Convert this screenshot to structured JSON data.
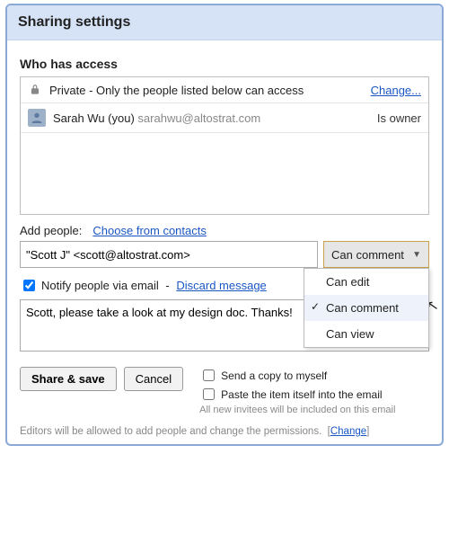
{
  "dialog": {
    "title": "Sharing settings"
  },
  "access": {
    "heading": "Who has access",
    "privacy_text": "Private - Only the people listed below can access",
    "change_link": "Change...",
    "owner": {
      "name": "Sarah Wu (you)",
      "email": "sarahwu@altostrat.com",
      "role": "Is owner"
    }
  },
  "add": {
    "label": "Add people:",
    "contacts_link": "Choose from contacts",
    "people_value": "\"Scott J\" <scott@altostrat.com>",
    "perm_selected": "Can comment",
    "perm_options": [
      "Can edit",
      "Can comment",
      "Can view"
    ]
  },
  "notify": {
    "checked": true,
    "label": "Notify people via email",
    "discard": "Discard message",
    "message": "Scott, please take a look at my design doc. Thanks!"
  },
  "options": {
    "send_copy": "Send a copy to myself",
    "paste_item": "Paste the item itself into the email",
    "fineprint": "All new invitees will be included on this email"
  },
  "buttons": {
    "share": "Share & save",
    "cancel": "Cancel"
  },
  "footer": {
    "text": "Editors will be allowed to add people and change the permissions.",
    "change": "Change"
  }
}
